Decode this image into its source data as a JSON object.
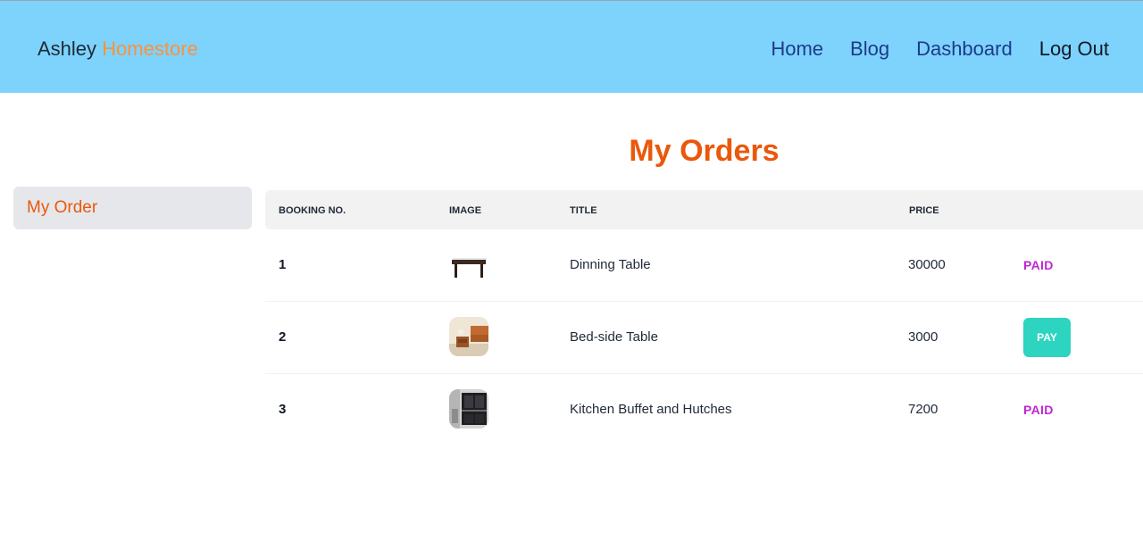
{
  "navbar": {
    "brand_part1": "Ashley",
    "brand_part2": "Homestore",
    "links": [
      "Home",
      "Blog",
      "Dashboard",
      "Log Out"
    ]
  },
  "sidebar": {
    "items": [
      {
        "label": "My Order"
      }
    ]
  },
  "main": {
    "title": "My Orders",
    "table": {
      "headers": [
        "BOOKING NO.",
        "IMAGE",
        "TITLE",
        "PRICE"
      ],
      "rows": [
        {
          "booking_no": "1",
          "image_icon": "dining-table-thumbnail",
          "title": "Dinning Table",
          "price": "30000",
          "status": "PAID"
        },
        {
          "booking_no": "2",
          "image_icon": "bedside-table-thumbnail",
          "title": "Bed-side Table",
          "price": "3000",
          "action": "PAY"
        },
        {
          "booking_no": "3",
          "image_icon": "kitchen-buffet-thumbnail",
          "title": "Kitchen Buffet and Hutches",
          "price": "7200",
          "status": "PAID"
        }
      ]
    }
  },
  "colors": {
    "navbar_bg": "#7dd3fc",
    "accent_orange": "#ea580c",
    "brand_accent": "#fb923c",
    "nav_link": "#1e3a8a",
    "paid_status": "#c026d3",
    "pay_button": "#2dd4bf"
  }
}
